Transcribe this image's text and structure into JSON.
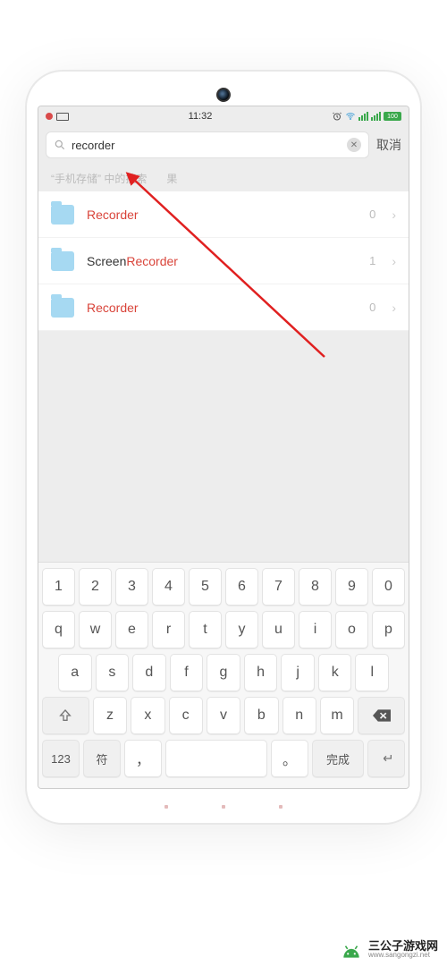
{
  "status": {
    "time": "11:32",
    "battery_text": "100"
  },
  "search": {
    "value": "recorder",
    "cancel_label": "取消"
  },
  "hint": {
    "prefix": "“手机存储” 中的搜索",
    "suffix": "果"
  },
  "results": [
    {
      "prefix": "",
      "highlight": "Recorder",
      "suffix": "",
      "count": "0"
    },
    {
      "prefix": "Screen",
      "highlight": "Recorder",
      "suffix": "",
      "count": "1"
    },
    {
      "prefix": "",
      "highlight": "Recorder",
      "suffix": "",
      "count": "0"
    }
  ],
  "keyboard": {
    "row1": [
      "1",
      "2",
      "3",
      "4",
      "5",
      "6",
      "7",
      "8",
      "9",
      "0"
    ],
    "row2": [
      "q",
      "w",
      "e",
      "r",
      "t",
      "y",
      "u",
      "i",
      "o",
      "p"
    ],
    "row3": [
      "a",
      "s",
      "d",
      "f",
      "g",
      "h",
      "j",
      "k",
      "l"
    ],
    "row4_letters": [
      "z",
      "x",
      "c",
      "v",
      "b",
      "n",
      "m"
    ],
    "row5": {
      "num": "123",
      "sym": "符",
      "comma": "，",
      "period": "。",
      "done": "完成"
    }
  },
  "watermark": {
    "title": "三公子游戏网",
    "url": "www.sangongzi.net"
  },
  "colors": {
    "highlight": "#d9443a",
    "folder": "#a6d9f2",
    "signal": "#3aa84c"
  }
}
